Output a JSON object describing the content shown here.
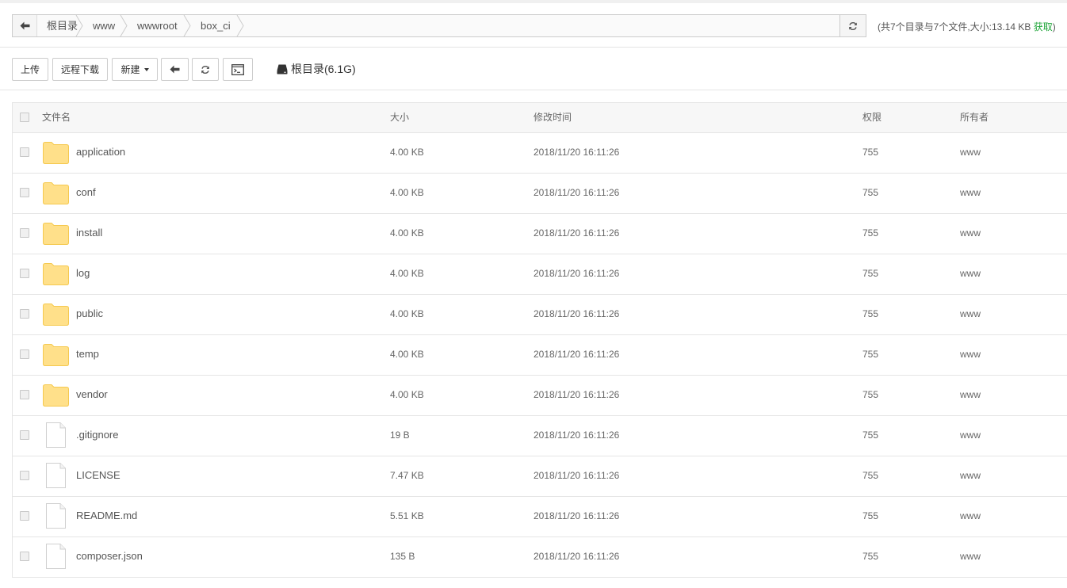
{
  "path_bar": {
    "crumbs": [
      "根目录",
      "www",
      "wwwroot",
      "box_ci"
    ]
  },
  "summary": {
    "text": "(共7个目录与7个文件,大小:13.14 KB",
    "fetch_label": "获取",
    "close_paren": ")"
  },
  "toolbar": {
    "upload_label": "上传",
    "remote_download_label": "远程下载",
    "new_label": "新建",
    "disk_label": "根目录(6.1G)"
  },
  "table": {
    "headers": {
      "name": "文件名",
      "size": "大小",
      "mtime": "修改时间",
      "perm": "权限",
      "owner": "所有者"
    },
    "rows": [
      {
        "type": "folder",
        "name": "application",
        "size": "4.00 KB",
        "mtime": "2018/11/20 16:11:26",
        "perm": "755",
        "owner": "www"
      },
      {
        "type": "folder",
        "name": "conf",
        "size": "4.00 KB",
        "mtime": "2018/11/20 16:11:26",
        "perm": "755",
        "owner": "www"
      },
      {
        "type": "folder",
        "name": "install",
        "size": "4.00 KB",
        "mtime": "2018/11/20 16:11:26",
        "perm": "755",
        "owner": "www"
      },
      {
        "type": "folder",
        "name": "log",
        "size": "4.00 KB",
        "mtime": "2018/11/20 16:11:26",
        "perm": "755",
        "owner": "www"
      },
      {
        "type": "folder",
        "name": "public",
        "size": "4.00 KB",
        "mtime": "2018/11/20 16:11:26",
        "perm": "755",
        "owner": "www"
      },
      {
        "type": "folder",
        "name": "temp",
        "size": "4.00 KB",
        "mtime": "2018/11/20 16:11:26",
        "perm": "755",
        "owner": "www"
      },
      {
        "type": "folder",
        "name": "vendor",
        "size": "4.00 KB",
        "mtime": "2018/11/20 16:11:26",
        "perm": "755",
        "owner": "www"
      },
      {
        "type": "file",
        "name": ".gitignore",
        "size": "19 B",
        "mtime": "2018/11/20 16:11:26",
        "perm": "755",
        "owner": "www"
      },
      {
        "type": "file",
        "name": "LICENSE",
        "size": "7.47 KB",
        "mtime": "2018/11/20 16:11:26",
        "perm": "755",
        "owner": "www"
      },
      {
        "type": "file",
        "name": "README.md",
        "size": "5.51 KB",
        "mtime": "2018/11/20 16:11:26",
        "perm": "755",
        "owner": "www"
      },
      {
        "type": "file",
        "name": "composer.json",
        "size": "135 B",
        "mtime": "2018/11/20 16:11:26",
        "perm": "755",
        "owner": "www"
      }
    ]
  },
  "colors": {
    "accent_green": "#20a53a",
    "folder_fill": "#ffe08a",
    "folder_stroke": "#f5c94f",
    "file_stroke": "#d0d0d0"
  },
  "icons": {
    "path_back": "arrow-left-icon",
    "path_refresh": "refresh-icon",
    "toolbar_back": "arrow-left-icon",
    "toolbar_refresh": "refresh-icon",
    "terminal": "terminal-icon",
    "disk": "hard-drive-icon",
    "folder": "folder-icon",
    "file": "file-icon"
  }
}
